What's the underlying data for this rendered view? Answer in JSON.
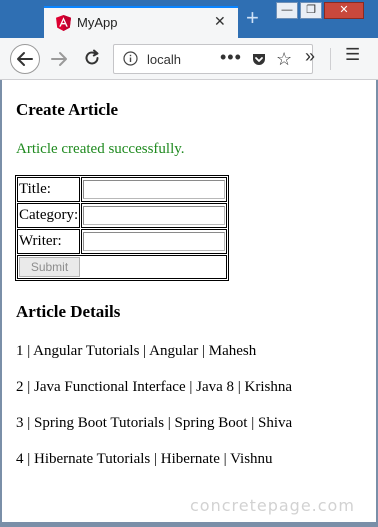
{
  "browser": {
    "tab_title": "MyApp",
    "tab_close": "✕",
    "new_tab": "+",
    "url": "localh",
    "page_actions": "•••",
    "overflow": "»",
    "menu": "☰",
    "minimize": "—",
    "maximize": "❐",
    "close": "✕",
    "icons": [
      "angular-icon",
      "back-arrow-icon",
      "forward-arrow-icon",
      "reload-icon",
      "info-icon",
      "pocket-icon",
      "star-icon",
      "overflow-chevron-icon",
      "hamburger-menu-icon"
    ]
  },
  "create_article": {
    "heading": "Create Article",
    "message": "Article created successfully.",
    "message_color": "#1f8a1f",
    "fields": [
      {
        "label": "Title:",
        "value": ""
      },
      {
        "label": "Category:",
        "value": ""
      },
      {
        "label": "Writer:",
        "value": ""
      }
    ],
    "submit_label": "Submit"
  },
  "article_details": {
    "heading": "Article Details",
    "rows": [
      "1 | Angular Tutorials | Angular | Mahesh",
      "2 | Java Functional Interface | Java 8 | Krishna",
      "3 | Spring Boot Tutorials | Spring Boot | Shiva",
      "4 | Hibernate Tutorials | Hibernate | Vishnu"
    ]
  },
  "watermark": "concretepage.com"
}
